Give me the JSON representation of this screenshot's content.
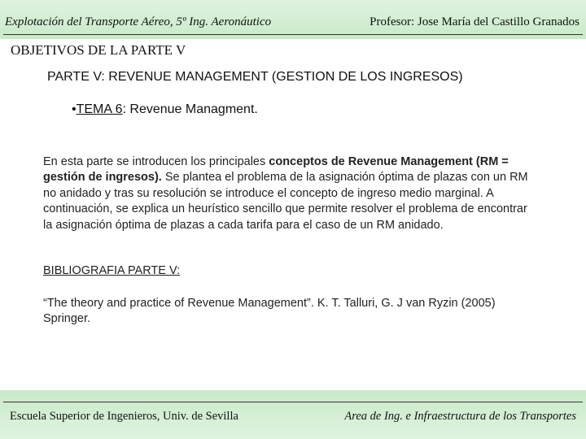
{
  "header": {
    "left": "Explotación del Transporte Aéreo, 5º Ing. Aeronáutico",
    "right": "Profesor: Jose María del Castillo Granados"
  },
  "section_title": "OBJETIVOS DE LA PARTE V",
  "part_title": "PARTE V: REVENUE MANAGEMENT (GESTION DE LOS INGRESOS)",
  "tema": {
    "bullet": "•",
    "label": "TEMA 6",
    "text": ": Revenue Managment."
  },
  "body": {
    "t1": "En esta parte se introducen los principales ",
    "b1": "conceptos de Revenue Management (RM = gestión de ingresos).",
    "t2": " Se plantea el problema de la asignación óptima de plazas con un RM no anidado y tras su resolución se introduce el concepto de ingreso medio marginal. A continuación,  se explica un heurístico sencillo que permite resolver el problema  de encontrar la asignación óptima de plazas a cada tarifa para el caso de un RM anidado."
  },
  "bibliography": {
    "title": "BIBLIOGRAFIA PARTE V:",
    "reference": "“The theory and practice of Revenue Management”. K. T. Talluri, G. J van Ryzin (2005) Springer."
  },
  "footer": {
    "left": "Escuela  Superior de Ingenieros, Univ. de Sevilla",
    "right": "Area de Ing. e Infraestructura de los Transportes"
  }
}
